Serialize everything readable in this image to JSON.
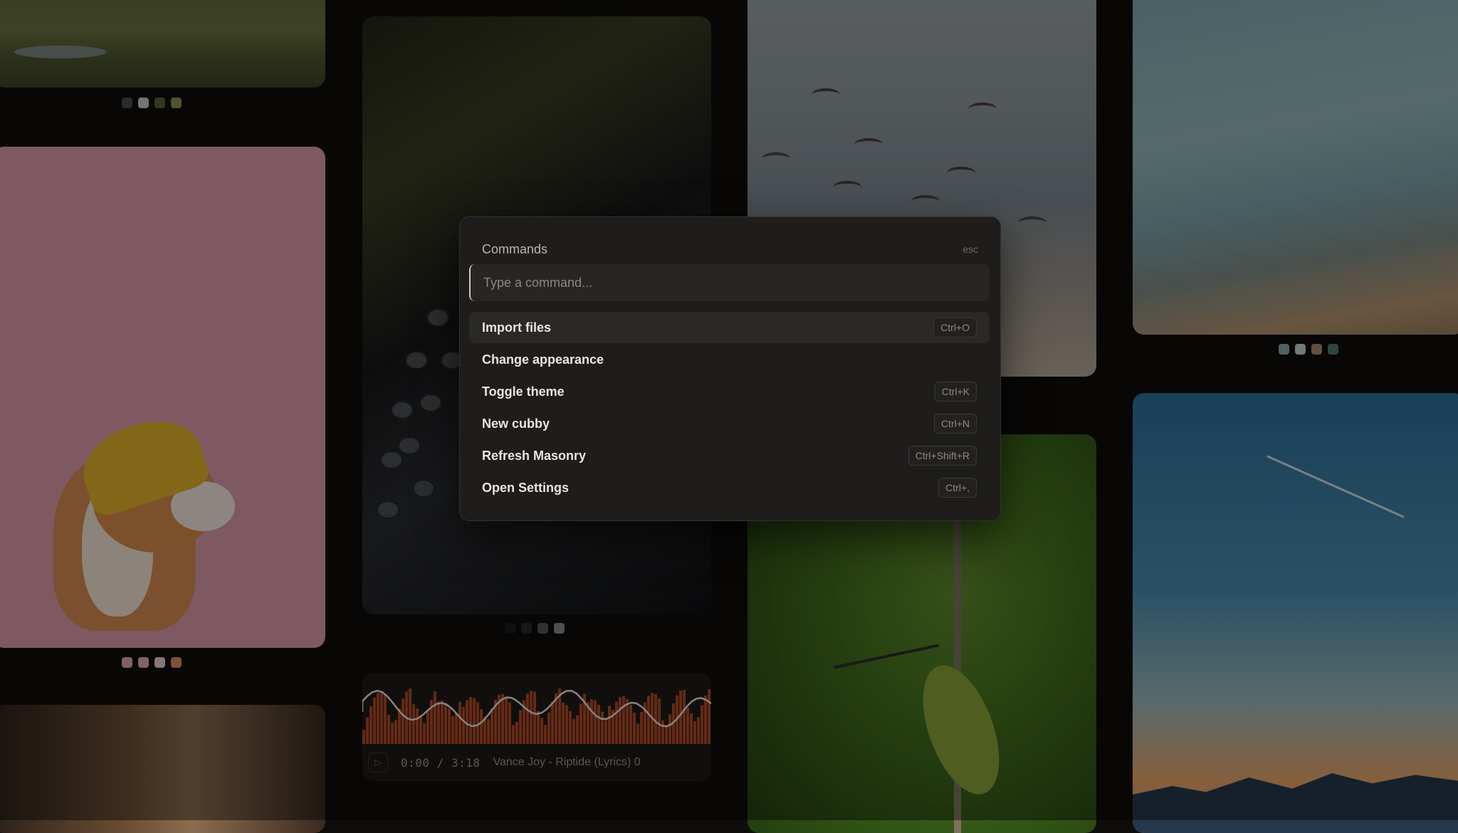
{
  "palette": {
    "title": "Commands",
    "esc_hint": "esc",
    "input_placeholder": "Type a command...",
    "items": [
      {
        "label": "Import files",
        "shortcut": "Ctrl+O"
      },
      {
        "label": "Change appearance",
        "shortcut": ""
      },
      {
        "label": "Toggle theme",
        "shortcut": "Ctrl+K"
      },
      {
        "label": "New cubby",
        "shortcut": "Ctrl+N"
      },
      {
        "label": "Refresh Masonry",
        "shortcut": "Ctrl+Shift+R"
      },
      {
        "label": "Open Settings",
        "shortcut": "Ctrl+,"
      }
    ]
  },
  "audio": {
    "play_icon": "play-icon",
    "time": "0:00 / 3:18",
    "track": "Vance Joy - Riptide (Lyrics) 0"
  },
  "palettes": {
    "landscape": [
      "#4a4a4a",
      "#c9c9c9",
      "#5a5f35",
      "#8a9150"
    ],
    "dog": [
      "#d7a7b0",
      "#e0a8b5",
      "#e8c9cf",
      "#d59065"
    ],
    "typewriter": [
      "#1b1b1b",
      "#2a2a2a",
      "#555555",
      "#8a8a8a"
    ],
    "linen": [
      "#87a9b0",
      "#c6cfd0",
      "#a58a6c",
      "#4f7b6f"
    ]
  },
  "colors": {
    "background": "#0e0d0c",
    "palette_bg": "#1e1d1c",
    "waveform": "#e05a2b"
  }
}
